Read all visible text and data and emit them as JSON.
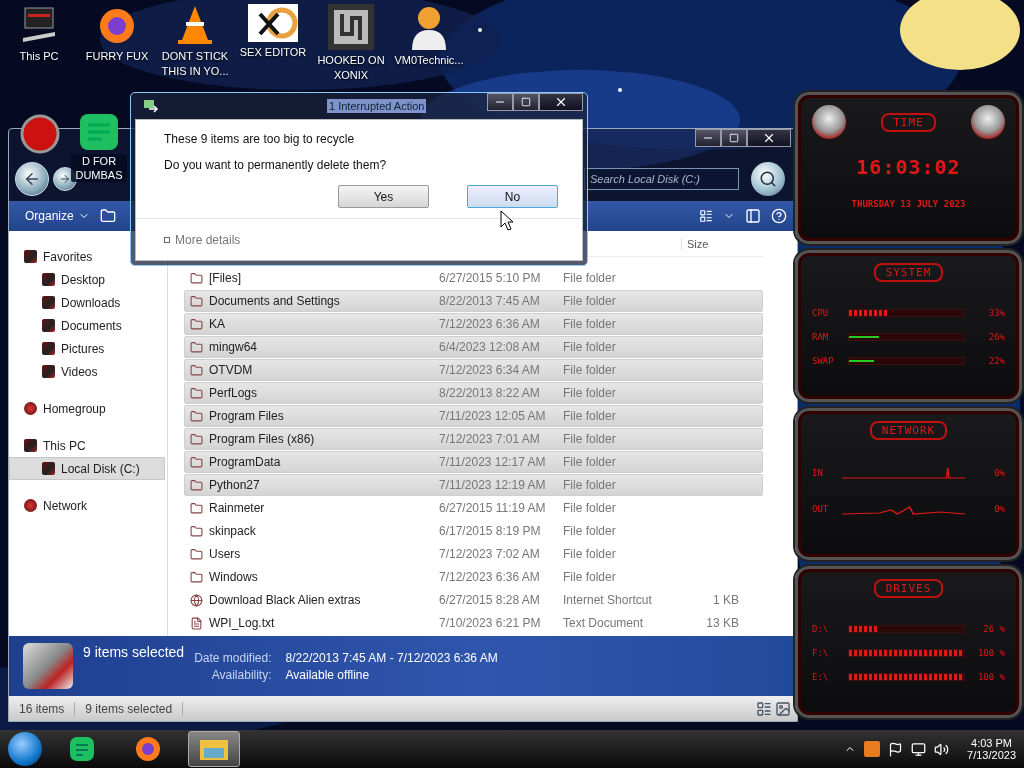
{
  "desktop": {
    "icons": [
      {
        "label": "This PC"
      },
      {
        "label": "FURRY FUX"
      },
      {
        "label": "DONT STICK THIS IN YO..."
      },
      {
        "label": "SEX EDITOR"
      },
      {
        "label": "HOOKED ON XONIX"
      },
      {
        "label": "VM0Technic..."
      }
    ],
    "second_row": [
      {
        "label": "D FOR DUMBAS"
      }
    ]
  },
  "explorer": {
    "search": {
      "placeholder": "Search Local Disk (C:)"
    },
    "toolbar": {
      "organize": "Organize"
    },
    "nav": [
      {
        "label": "Favorites",
        "selected": false,
        "children": [
          {
            "label": "Desktop",
            "selected": false
          },
          {
            "label": "Downloads",
            "selected": false
          },
          {
            "label": "Documents",
            "selected": false
          },
          {
            "label": "Pictures",
            "selected": false
          },
          {
            "label": "Videos",
            "selected": false
          }
        ]
      },
      {
        "label": "Homegroup",
        "selected": false
      },
      {
        "label": "This PC",
        "selected": false,
        "children": [
          {
            "label": "Local Disk (C:)",
            "selected": true
          }
        ]
      },
      {
        "label": "Network",
        "selected": false
      }
    ],
    "column_header": "Size",
    "files": [
      {
        "name": "[Files]",
        "date": "6/27/2015 5:10 PM",
        "type": "File folder",
        "selected": false
      },
      {
        "name": "Documents and Settings",
        "date": "8/22/2013 7:45 AM",
        "type": "File folder",
        "selected": true
      },
      {
        "name": "KA",
        "date": "7/12/2023 6:36 AM",
        "type": "File folder",
        "selected": true
      },
      {
        "name": "mingw64",
        "date": "6/4/2023 12:08 AM",
        "type": "File folder",
        "selected": true
      },
      {
        "name": "OTVDM",
        "date": "7/12/2023 6:34 AM",
        "type": "File folder",
        "selected": true
      },
      {
        "name": "PerfLogs",
        "date": "8/22/2013 8:22 AM",
        "type": "File folder",
        "selected": true
      },
      {
        "name": "Program Files",
        "date": "7/11/2023 12:05 AM",
        "type": "File folder",
        "selected": true
      },
      {
        "name": "Program Files (x86)",
        "date": "7/12/2023 7:01 AM",
        "type": "File folder",
        "selected": true
      },
      {
        "name": "ProgramData",
        "date": "7/11/2023 12:17 AM",
        "type": "File folder",
        "selected": true
      },
      {
        "name": "Python27",
        "date": "7/11/2023 12:19 AM",
        "type": "File folder",
        "selected": true
      },
      {
        "name": "Rainmeter",
        "date": "6/27/2015 11:19 AM",
        "type": "File folder",
        "selected": false
      },
      {
        "name": "skinpack",
        "date": "6/17/2015 8:19 PM",
        "type": "File folder",
        "selected": false
      },
      {
        "name": "Users",
        "date": "7/12/2023 7:02 AM",
        "type": "File folder",
        "selected": false
      },
      {
        "name": "Windows",
        "date": "7/12/2023 6:36 AM",
        "type": "File folder",
        "selected": false
      },
      {
        "name": "Download Black Alien extras",
        "date": "6/27/2015 8:28 AM",
        "type": "Internet Shortcut",
        "size": "1 KB",
        "selected": false
      },
      {
        "name": "WPI_Log.txt",
        "date": "7/10/2023 6:21 PM",
        "type": "Text Document",
        "size": "13 KB",
        "selected": false
      }
    ],
    "details": {
      "title": "9 items selected",
      "fields": [
        {
          "label": "Date modified:",
          "value": "8/22/2013 7:45 AM - 7/12/2023 6:36 AM"
        },
        {
          "label": "Availability:",
          "value": "Available offline"
        }
      ]
    },
    "status_bar": [
      "16 items",
      "9 items selected"
    ]
  },
  "dialog": {
    "title": "1 Interrupted Action",
    "message": "These 9 items are too big to recycle",
    "question": "Do you want to permanently delete them?",
    "buttons": [
      {
        "label": "Yes",
        "focused": false
      },
      {
        "label": "No",
        "focused": true
      }
    ],
    "more_details": "More details"
  },
  "widgets": [
    {
      "kind": "clock",
      "title": "TIME",
      "time": "16:03:02",
      "date": "THURSDAY 13 JULY 2023"
    },
    {
      "kind": "meters",
      "title": "SYSTEM",
      "rows": [
        {
          "label": "CPU",
          "kind": "chevron",
          "level": 0.33,
          "reading": "33%"
        },
        {
          "label": "RAM",
          "kind": "line",
          "level": 0.26,
          "reading": "26%"
        },
        {
          "label": "SWAP",
          "kind": "line",
          "level": 0.22,
          "reading": "22%"
        }
      ]
    },
    {
      "kind": "graphs",
      "title": "NETWORK",
      "rows": [
        {
          "label": "IN",
          "reading": "0%"
        },
        {
          "label": "OUT",
          "reading": "0%"
        }
      ]
    },
    {
      "kind": "meters",
      "title": "DRIVES",
      "rows": [
        {
          "label": "D:\\",
          "kind": "chevron",
          "level": 0.26,
          "reading": "26 %"
        },
        {
          "label": "F:\\",
          "kind": "chevron",
          "level": 1,
          "reading": "100 %"
        },
        {
          "label": "E:\\",
          "kind": "chevron",
          "level": 1,
          "reading": "100 %"
        }
      ]
    }
  ],
  "taskbar": {
    "apps": [
      {
        "active": false
      },
      {
        "active": false
      },
      {
        "active": true
      }
    ],
    "clock": {
      "time": "4:03 PM",
      "date": "7/13/2023"
    }
  }
}
